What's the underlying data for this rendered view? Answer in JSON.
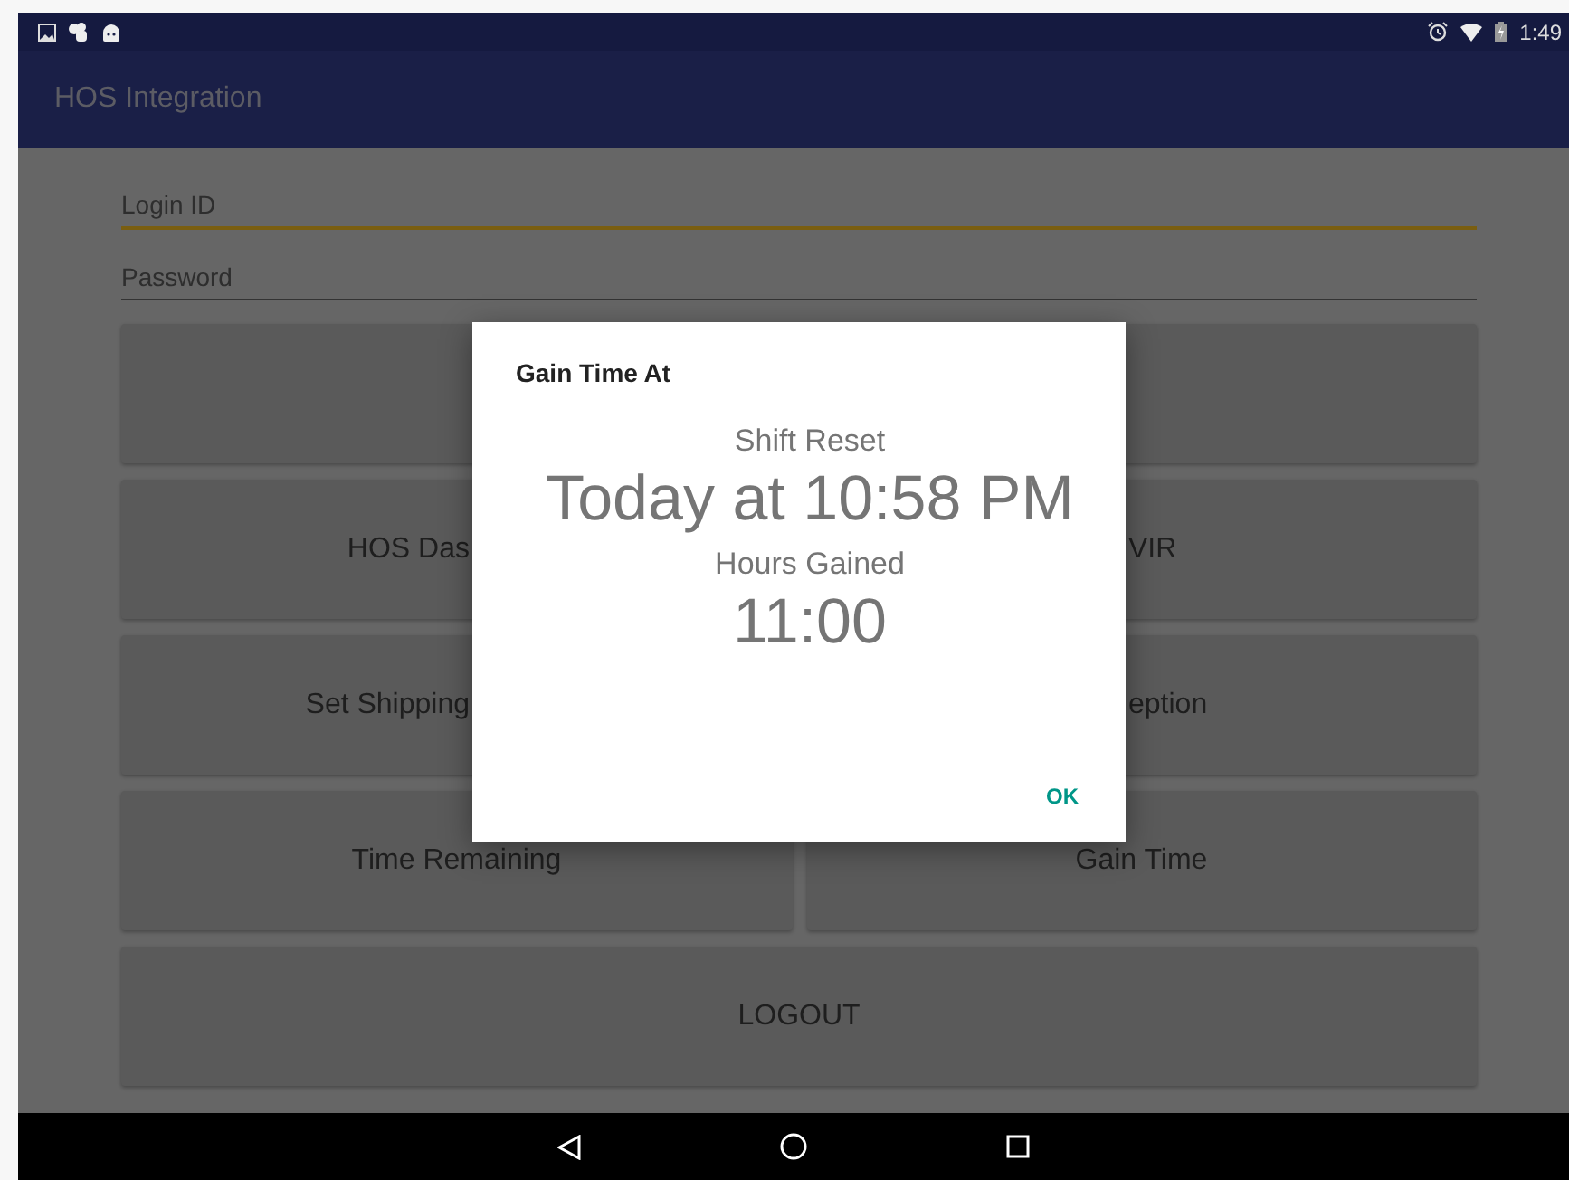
{
  "status_bar": {
    "time": "1:49"
  },
  "app_bar": {
    "title": "HOS Integration"
  },
  "form": {
    "fields": [
      {
        "placeholder": "Login ID",
        "focused": true
      },
      {
        "placeholder": "Password",
        "focused": false
      }
    ]
  },
  "button_rows": [
    {
      "buttons": [
        {
          "kind": "covered"
        }
      ]
    },
    {
      "buttons": [
        {
          "label": "HOS Das",
          "kind": "cutright"
        },
        {
          "label": "VIR",
          "kind": "cutleft"
        }
      ]
    },
    {
      "buttons": [
        {
          "label": "Set Shipping",
          "kind": "cutright"
        },
        {
          "label": "eption",
          "kind": "cutleft"
        }
      ]
    },
    {
      "buttons": [
        {
          "label": "Time Remaining",
          "kind": "plain"
        },
        {
          "label": "Gain Time",
          "kind": "plain"
        }
      ]
    },
    {
      "buttons": [
        {
          "label": "LOGOUT",
          "kind": "plain"
        }
      ]
    }
  ],
  "dialog": {
    "title": "Gain Time At",
    "lines": [
      {
        "text": "Shift Reset",
        "kind": "label"
      },
      {
        "text": "Today at 10:58 PM",
        "kind": "value"
      },
      {
        "text": "Hours Gained",
        "kind": "label"
      },
      {
        "text": "11:00",
        "kind": "value"
      }
    ],
    "button": "OK"
  }
}
